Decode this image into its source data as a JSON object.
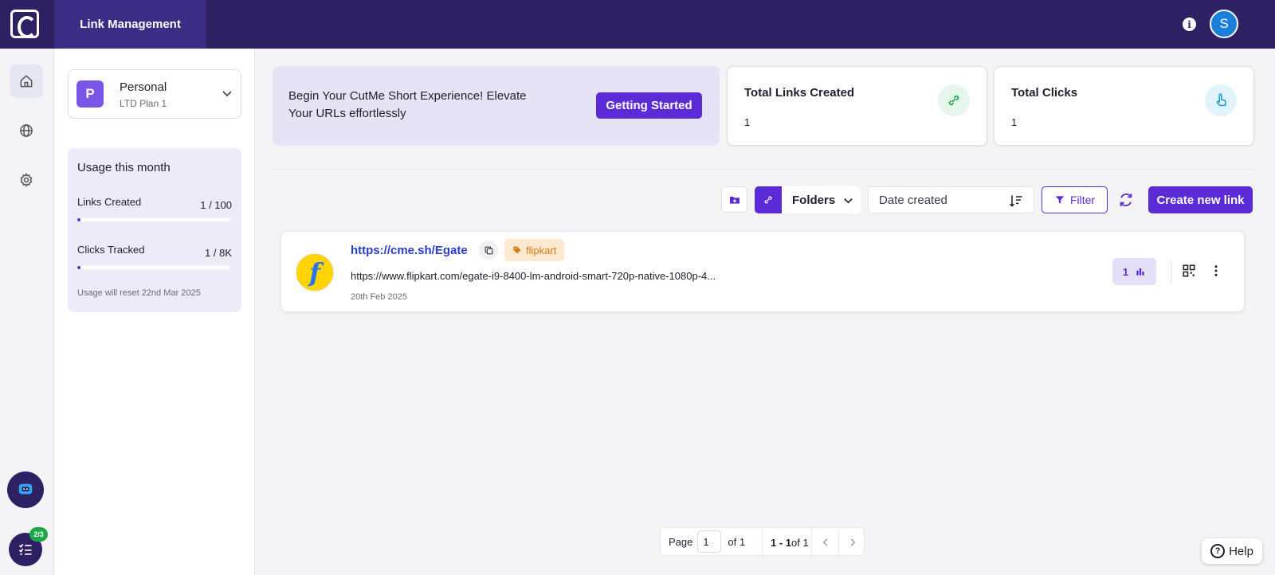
{
  "header": {
    "tab_label": "Link Management",
    "info_icon": "info-icon",
    "avatar_initial": "S"
  },
  "rail": {
    "items": [
      {
        "name": "home",
        "icon": "home-icon",
        "active": true
      },
      {
        "name": "globe",
        "icon": "globe-icon",
        "active": false
      },
      {
        "name": "settings",
        "icon": "gear-icon",
        "active": false
      }
    ],
    "tasks_badge": "2/3"
  },
  "workspace": {
    "initial": "P",
    "name": "Personal",
    "plan": "LTD Plan 1"
  },
  "usage": {
    "title": "Usage this month",
    "links_label": "Links Created",
    "links_value": "1 / 100",
    "links_fraction": 0.01,
    "clicks_label": "Clicks Tracked",
    "clicks_value": "1 / 8K",
    "clicks_fraction": 0.000125,
    "reset_note": "Usage will reset 22nd Mar 2025"
  },
  "banner": {
    "text": "Begin Your CutMe Short Experience! Elevate Your URLs effortlessly",
    "button": "Getting Started"
  },
  "stats": [
    {
      "title": "Total Links Created",
      "value": "1",
      "icon": "link-icon"
    },
    {
      "title": "Total Clicks",
      "value": "1",
      "icon": "pointer-hand-icon"
    }
  ],
  "toolbar": {
    "folders_label": "Folders",
    "sort_label": "Date created",
    "filter_label": "Filter",
    "create_label": "Create new link"
  },
  "links": [
    {
      "short_url": "https://cme.sh/Egate",
      "tag": "flipkart",
      "long_url": "https://www.flipkart.com/egate-i9-8400-lm-android-smart-720p-native-1080p-4...",
      "created": "20th Feb 2025",
      "clicks": "1",
      "favicon_letter": "f"
    }
  ],
  "pagination": {
    "page_label": "Page",
    "page_value": "1",
    "of_label": "of 1",
    "range_bold": "1 - 1",
    "range_rest": " of 1"
  },
  "help_label": "Help",
  "colors": {
    "topbar": "#2d2164",
    "accent": "#5a2bd6",
    "tag_bg": "#fde9cf",
    "tag_fg": "#d57b17"
  }
}
